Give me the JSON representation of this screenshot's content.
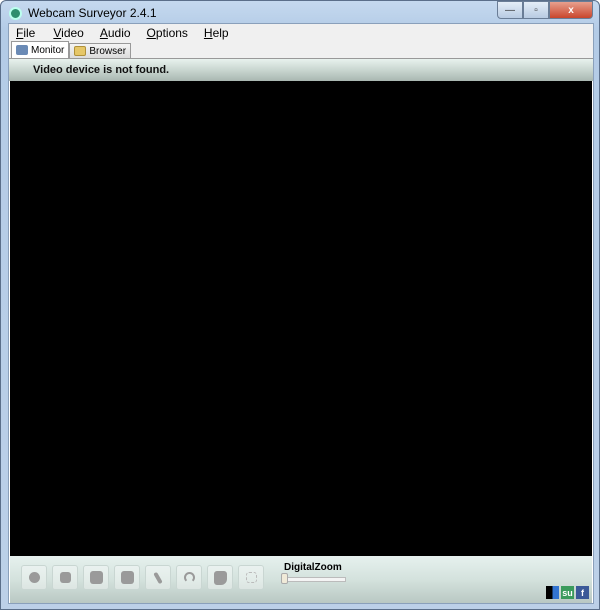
{
  "window": {
    "title": "Webcam Surveyor 2.4.1",
    "minimize": "—",
    "maximize": "▫",
    "close": "x"
  },
  "menu": [
    "File",
    "Video",
    "Audio",
    "Options",
    "Help"
  ],
  "tabs": [
    {
      "label": "Monitor",
      "active": true
    },
    {
      "label": "Browser",
      "active": false
    }
  ],
  "status": "Video device is not found.",
  "toolbar": {
    "buttons": [
      "snapshot-icon",
      "record-icon",
      "motion-detect-icon",
      "schedule-icon",
      "tools-icon",
      "broadcast-icon",
      "audio-icon",
      "fullscreen-icon"
    ],
    "zoom_label": "DigitalZoom",
    "zoom_value": 0
  },
  "social": [
    {
      "name": "delicious",
      "label": ""
    },
    {
      "name": "stumbleupon",
      "label": "su"
    },
    {
      "name": "facebook",
      "label": "f"
    }
  ]
}
